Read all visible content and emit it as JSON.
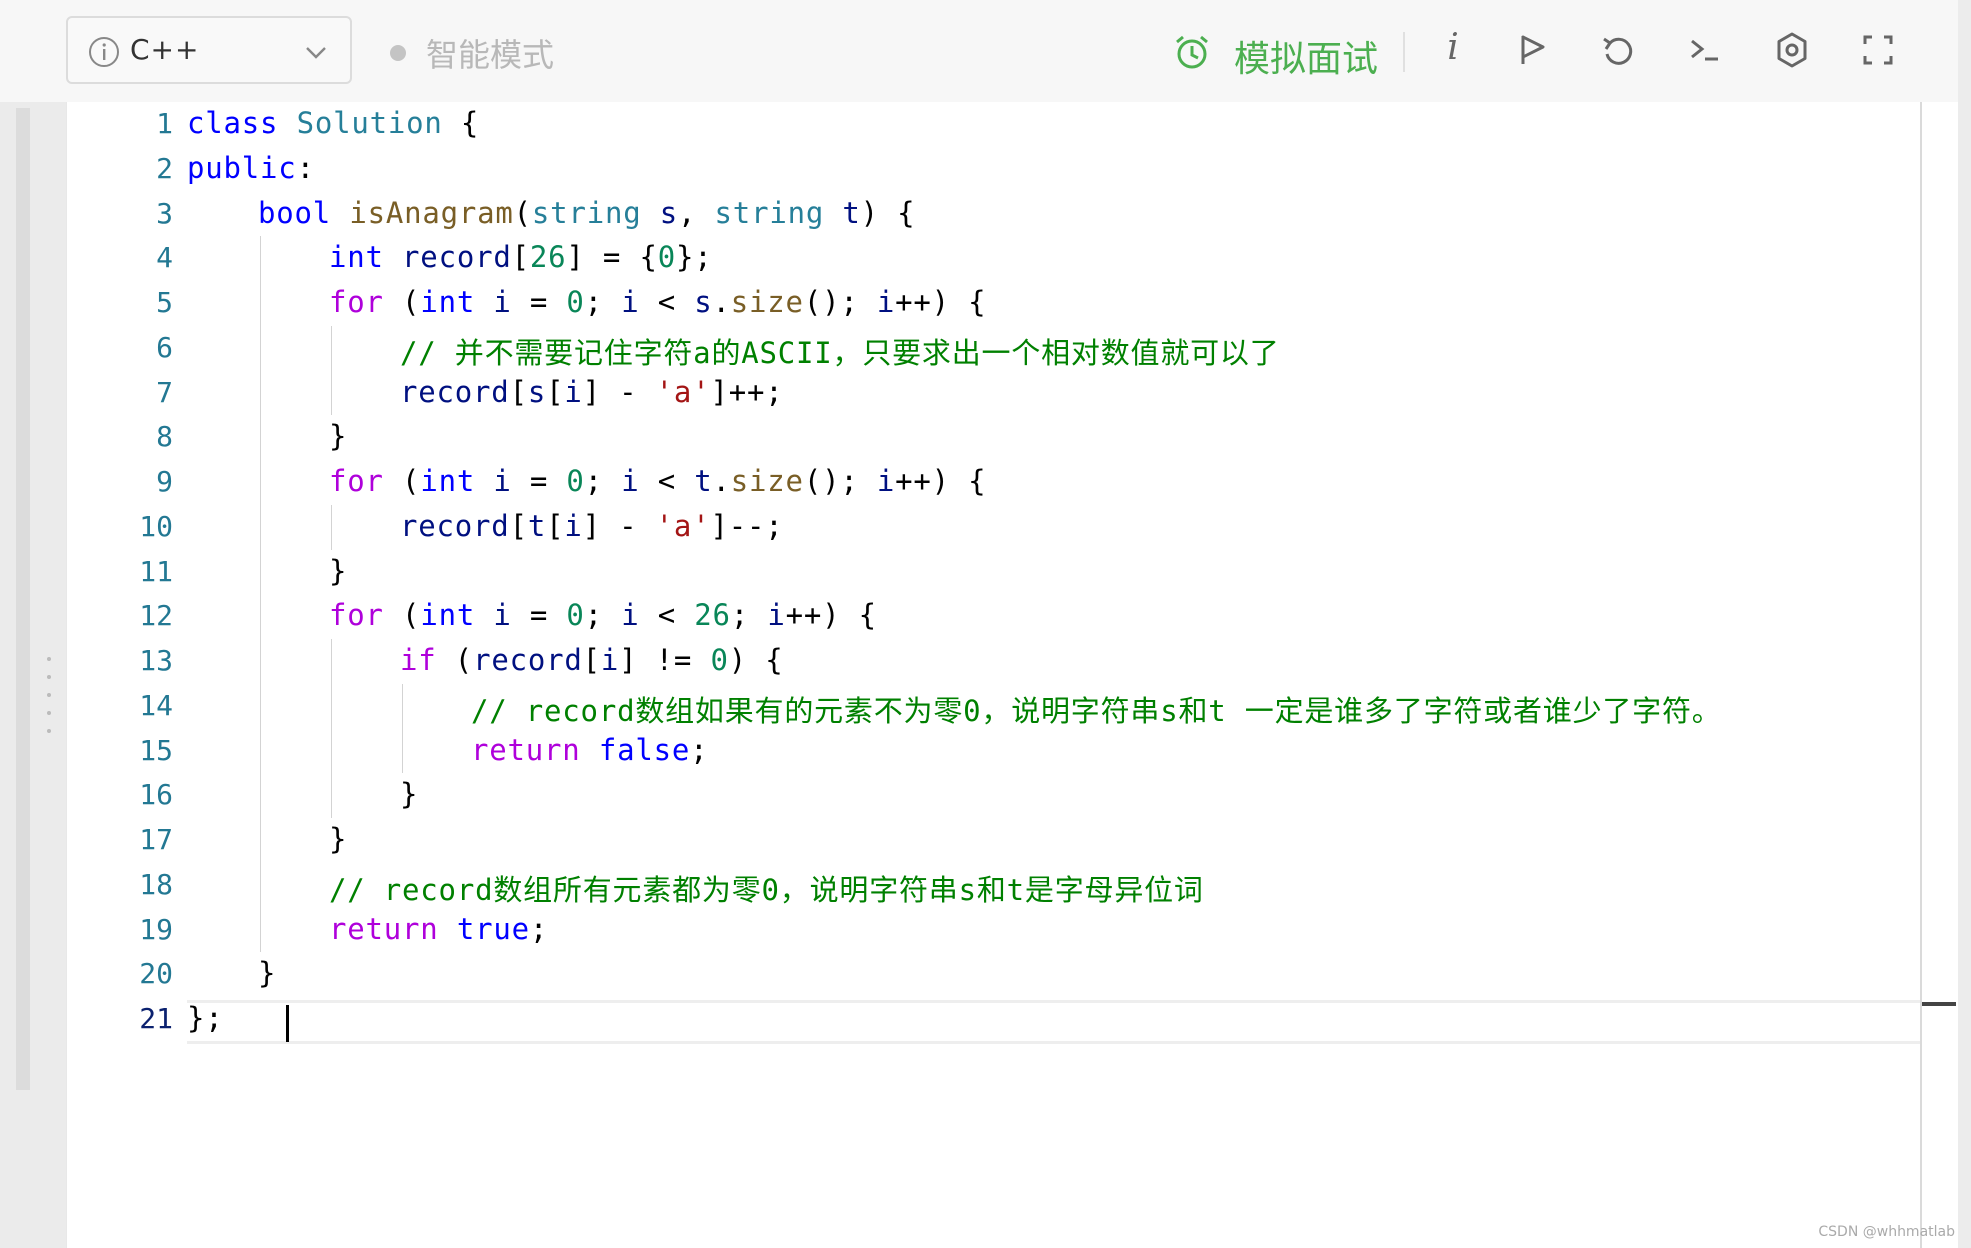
{
  "toolbar": {
    "language": "C++",
    "mode_label": "智能模式",
    "mock_interview_label": "模拟面试",
    "info_label": "i",
    "icons": [
      "info-icon",
      "chevron-down-icon",
      "alarm-clock-icon",
      "info-italic-icon",
      "run-flag-icon",
      "reset-icon",
      "console-icon",
      "settings-icon",
      "fullscreen-icon"
    ],
    "accent_color": "#4caf50"
  },
  "editor": {
    "language": "cpp",
    "cursor_line": 21,
    "lines": [
      {
        "n": "1",
        "indent": 0,
        "tokens": [
          [
            "kw",
            "class"
          ],
          [
            "",
            ""
          ],
          [
            "typ",
            " Solution"
          ],
          [
            "",
            ""
          ],
          [
            "",
            " {"
          ]
        ]
      },
      {
        "n": "2",
        "indent": 0,
        "tokens": [
          [
            "kw",
            "public"
          ],
          [
            "",
            ":"
          ]
        ]
      },
      {
        "n": "3",
        "indent": 1,
        "tokens": [
          [
            "kw",
            "bool"
          ],
          [
            "",
            " "
          ],
          [
            "fn",
            "isAnagram"
          ],
          [
            "",
            "("
          ],
          [
            "typ",
            "string"
          ],
          [
            "",
            " "
          ],
          [
            "var",
            "s"
          ],
          [
            "",
            ", "
          ],
          [
            "typ",
            "string"
          ],
          [
            "",
            " "
          ],
          [
            "var",
            "t"
          ],
          [
            "",
            ") {"
          ]
        ]
      },
      {
        "n": "4",
        "indent": 2,
        "tokens": [
          [
            "kw",
            "int"
          ],
          [
            "",
            " "
          ],
          [
            "var",
            "record"
          ],
          [
            "",
            "["
          ],
          [
            "num",
            "26"
          ],
          [
            "",
            "] = {"
          ],
          [
            "num",
            "0"
          ],
          [
            "",
            "};"
          ]
        ]
      },
      {
        "n": "5",
        "indent": 2,
        "tokens": [
          [
            "ctl",
            "for"
          ],
          [
            "",
            " ("
          ],
          [
            "kw",
            "int"
          ],
          [
            "",
            " "
          ],
          [
            "var",
            "i"
          ],
          [
            "",
            " = "
          ],
          [
            "num",
            "0"
          ],
          [
            "",
            "; "
          ],
          [
            "var",
            "i"
          ],
          [
            "",
            " < "
          ],
          [
            "var",
            "s"
          ],
          [
            "",
            "."
          ],
          [
            "fn",
            "size"
          ],
          [
            "",
            "(); "
          ],
          [
            "var",
            "i"
          ],
          [
            "",
            "++) {"
          ]
        ]
      },
      {
        "n": "6",
        "indent": 3,
        "tokens": [
          [
            "cmt",
            "// 并不需要记住字符a的ASCII，只要求出一个相对数值就可以了"
          ]
        ]
      },
      {
        "n": "7",
        "indent": 3,
        "tokens": [
          [
            "var",
            "record"
          ],
          [
            "",
            "["
          ],
          [
            "var",
            "s"
          ],
          [
            "",
            "["
          ],
          [
            "var",
            "i"
          ],
          [
            "",
            "] - "
          ],
          [
            "str",
            "'a'"
          ],
          [
            "",
            "]++;"
          ]
        ]
      },
      {
        "n": "8",
        "indent": 2,
        "tokens": [
          [
            "",
            "}"
          ]
        ]
      },
      {
        "n": "9",
        "indent": 2,
        "tokens": [
          [
            "ctl",
            "for"
          ],
          [
            "",
            " ("
          ],
          [
            "kw",
            "int"
          ],
          [
            "",
            " "
          ],
          [
            "var",
            "i"
          ],
          [
            "",
            " = "
          ],
          [
            "num",
            "0"
          ],
          [
            "",
            "; "
          ],
          [
            "var",
            "i"
          ],
          [
            "",
            " < "
          ],
          [
            "var",
            "t"
          ],
          [
            "",
            "."
          ],
          [
            "fn",
            "size"
          ],
          [
            "",
            "(); "
          ],
          [
            "var",
            "i"
          ],
          [
            "",
            "++) {"
          ]
        ]
      },
      {
        "n": "10",
        "indent": 3,
        "tokens": [
          [
            "var",
            "record"
          ],
          [
            "",
            "["
          ],
          [
            "var",
            "t"
          ],
          [
            "",
            "["
          ],
          [
            "var",
            "i"
          ],
          [
            "",
            "] - "
          ],
          [
            "str",
            "'a'"
          ],
          [
            "",
            "]--;"
          ]
        ]
      },
      {
        "n": "11",
        "indent": 2,
        "tokens": [
          [
            "",
            "}"
          ]
        ]
      },
      {
        "n": "12",
        "indent": 2,
        "tokens": [
          [
            "ctl",
            "for"
          ],
          [
            "",
            " ("
          ],
          [
            "kw",
            "int"
          ],
          [
            "",
            " "
          ],
          [
            "var",
            "i"
          ],
          [
            "",
            " = "
          ],
          [
            "num",
            "0"
          ],
          [
            "",
            "; "
          ],
          [
            "var",
            "i"
          ],
          [
            "",
            " < "
          ],
          [
            "num",
            "26"
          ],
          [
            "",
            "; "
          ],
          [
            "var",
            "i"
          ],
          [
            "",
            "++) {"
          ]
        ]
      },
      {
        "n": "13",
        "indent": 3,
        "tokens": [
          [
            "ctl",
            "if"
          ],
          [
            "",
            " ("
          ],
          [
            "var",
            "record"
          ],
          [
            "",
            "["
          ],
          [
            "var",
            "i"
          ],
          [
            "",
            "] != "
          ],
          [
            "num",
            "0"
          ],
          [
            "",
            ") {"
          ]
        ]
      },
      {
        "n": "14",
        "indent": 4,
        "tokens": [
          [
            "cmt",
            "// record数组如果有的元素不为零0，说明字符串s和t 一定是谁多了字符或者谁少了字符。"
          ]
        ]
      },
      {
        "n": "15",
        "indent": 4,
        "tokens": [
          [
            "ctl",
            "return"
          ],
          [
            "",
            " "
          ],
          [
            "kw",
            "false"
          ],
          [
            "",
            ";"
          ]
        ]
      },
      {
        "n": "16",
        "indent": 3,
        "tokens": [
          [
            "",
            "}"
          ]
        ]
      },
      {
        "n": "17",
        "indent": 2,
        "tokens": [
          [
            "",
            "}"
          ]
        ]
      },
      {
        "n": "18",
        "indent": 2,
        "tokens": [
          [
            "cmt",
            "// record数组所有元素都为零0，说明字符串s和t是字母异位词"
          ]
        ]
      },
      {
        "n": "19",
        "indent": 2,
        "tokens": [
          [
            "ctl",
            "return"
          ],
          [
            "",
            " "
          ],
          [
            "kw",
            "true"
          ],
          [
            "",
            ";"
          ]
        ]
      },
      {
        "n": "20",
        "indent": 1,
        "tokens": [
          [
            "",
            "}"
          ]
        ]
      },
      {
        "n": "21",
        "indent": 0,
        "tokens": [
          [
            "",
            "};"
          ]
        ]
      }
    ]
  },
  "watermark": "CSDN @whhmatlab"
}
